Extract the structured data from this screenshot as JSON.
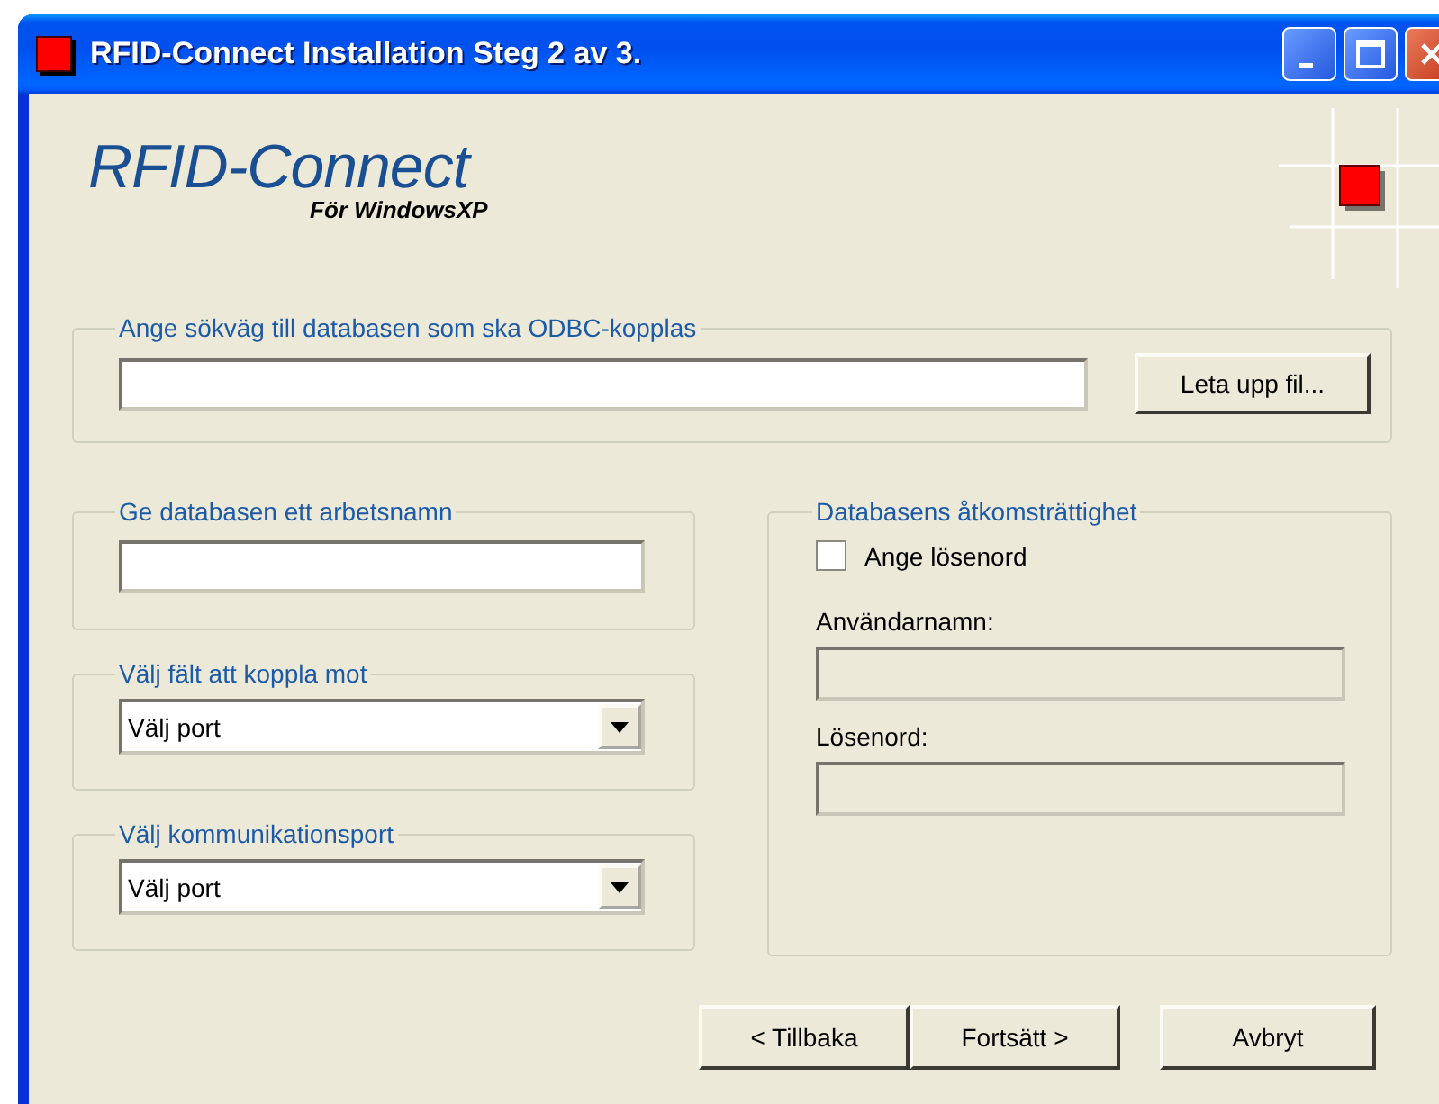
{
  "window": {
    "title": "RFID-Connect Installation Steg 2 av 3."
  },
  "logo": {
    "name": "RFID-Connect",
    "subtitle": "För WindowsXP"
  },
  "database_path": {
    "legend": "Ange sökväg till databasen som ska ODBC-kopplas",
    "browse_button": "Leta upp fil..."
  },
  "work_name": {
    "legend": "Ge databasen ett arbetsnamn"
  },
  "field_select": {
    "legend": "Välj fält att koppla mot",
    "value": "Välj port"
  },
  "port_select": {
    "legend": "Välj kommunikationsport",
    "value": "Välj port"
  },
  "access": {
    "legend": "Databasens åtkomsträttighet",
    "password_checkbox": {
      "label": "Ange lösenord",
      "checked": false
    },
    "fields": [
      {
        "label": "Användarnamn:",
        "disabled": true
      },
      {
        "label": "Lösenord:",
        "disabled": true
      }
    ]
  },
  "buttons": [
    "< Tillbaka",
    "Fortsätt >",
    "Avbryt"
  ]
}
